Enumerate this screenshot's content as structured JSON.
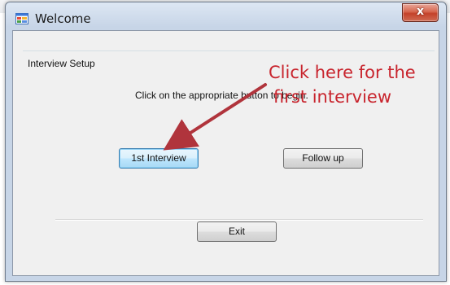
{
  "window": {
    "title": "Welcome",
    "close_glyph": "x"
  },
  "group": {
    "label": "Interview Setup",
    "instruction": "Click on the appropriate button to begin."
  },
  "buttons": {
    "first_interview": "1st Interview",
    "follow_up": "Follow up",
    "exit": "Exit"
  },
  "annotation": {
    "line1": "Click here for the",
    "line2": "first interview",
    "color": "#c8242d"
  },
  "icons": {
    "app_icon": "application-form-icon",
    "close_icon": "close-icon"
  }
}
